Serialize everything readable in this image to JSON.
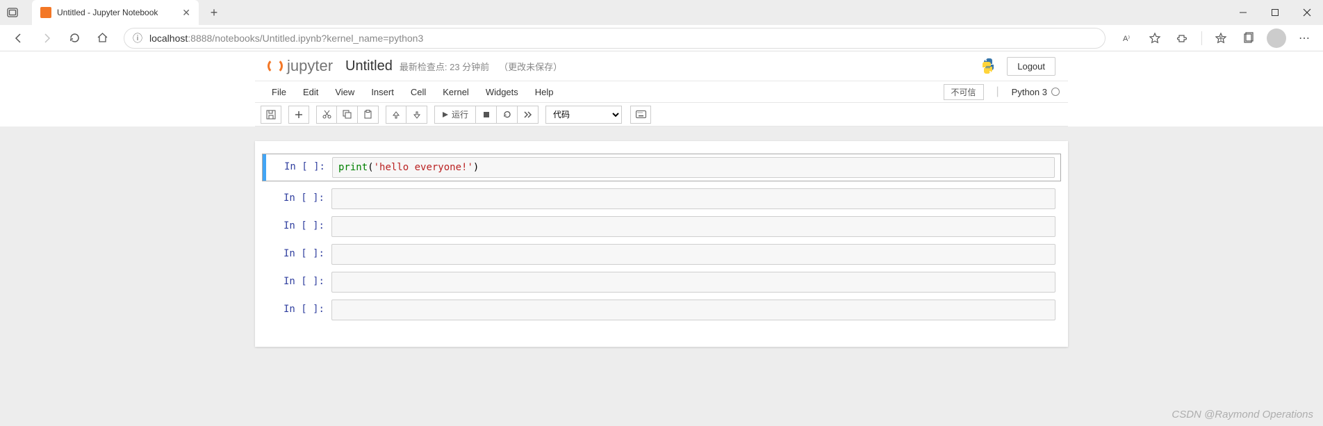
{
  "browser": {
    "tab_title": "Untitled - Jupyter Notebook",
    "url_info_glyph": "ⓘ",
    "url_host": "localhost",
    "url_port_path": ":8888/notebooks/Untitled.ipynb?kernel_name=python3"
  },
  "header": {
    "logo_text": "jupyter",
    "title": "Untitled",
    "checkpoint": "最新检查点: 23 分钟前",
    "save_status": "（更改未保存）",
    "logout": "Logout"
  },
  "menu": {
    "items": [
      "File",
      "Edit",
      "View",
      "Insert",
      "Cell",
      "Kernel",
      "Widgets",
      "Help"
    ],
    "trust": "不可信",
    "kernel": "Python 3"
  },
  "toolbar": {
    "run_label": "运行",
    "celltype": "代码"
  },
  "cells": [
    {
      "prompt": "In [ ]:",
      "code_func": "print",
      "code_paren_open": "(",
      "code_str": "'hello everyone!'",
      "code_paren_close": ")",
      "selected": true
    },
    {
      "prompt": "In [ ]:",
      "code": ""
    },
    {
      "prompt": "In [ ]:",
      "code": ""
    },
    {
      "prompt": "In [ ]:",
      "code": ""
    },
    {
      "prompt": "In [ ]:",
      "code": ""
    },
    {
      "prompt": "In [ ]:",
      "code": ""
    }
  ],
  "watermark": "CSDN @Raymond Operations"
}
